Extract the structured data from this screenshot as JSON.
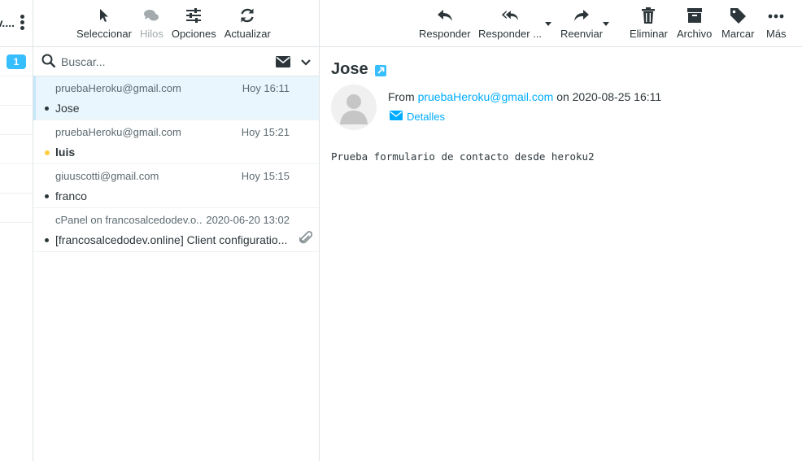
{
  "folders_column": {
    "truncated_label": "v....",
    "unread_count": "1"
  },
  "list_toolbar": {
    "select_label": "Seleccionar",
    "threads_label": "Hilos",
    "options_label": "Opciones",
    "refresh_label": "Actualizar"
  },
  "search": {
    "placeholder": "Buscar..."
  },
  "messages": [
    {
      "from": "pruebaHeroku@gmail.com",
      "date": "Hoy 16:11",
      "subject": "Jose"
    },
    {
      "from": "pruebaHeroku@gmail.com",
      "date": "Hoy 15:21",
      "subject": "luis"
    },
    {
      "from": "giuuscotti@gmail.com",
      "date": "Hoy 15:15",
      "subject": "franco"
    },
    {
      "from": "cPanel on francosalcedodev.o...",
      "date": "2020-06-20 13:02",
      "subject": "[francosalcedodev.online] Client configuratio..."
    }
  ],
  "message_toolbar": {
    "reply_label": "Responder",
    "reply_all_label": "Responder ...",
    "forward_label": "Reenviar",
    "delete_label": "Eliminar",
    "archive_label": "Archivo",
    "mark_label": "Marcar",
    "more_label": "Más"
  },
  "preview": {
    "subject": "Jose",
    "from_prefix": "From",
    "from_address": "pruebaHeroku@gmail.com",
    "date_text": "on 2020-08-25 16:11",
    "details_label": "Detalles",
    "body": "Prueba formulario de contacto desde heroku2"
  },
  "colors": {
    "accent": "#00acff",
    "badge": "#37beff",
    "selected_row": "#eaf6fe",
    "flag": "#ffce3d"
  }
}
